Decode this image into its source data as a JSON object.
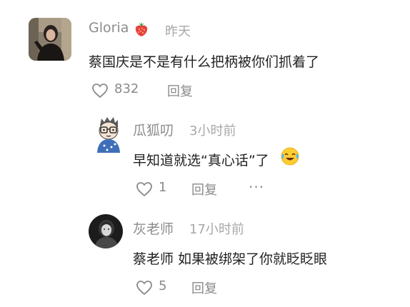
{
  "comments": [
    {
      "author": "Gloria",
      "author_emoji": "strawberry-icon",
      "time": "昨天",
      "text": "蔡国庆是不是有什么把柄被你们抓着了",
      "likes": "832",
      "reply_label": "回复",
      "replies": [
        {
          "author": "瓜狐叨",
          "time": "3小时前",
          "text": "早知道就选“真心话”了",
          "text_emoji": "laugh-cry-emoji",
          "likes": "1",
          "reply_label": "回复",
          "more_label": "···"
        },
        {
          "author": "灰老师",
          "time": "17小时前",
          "text": "蔡老师 如果被绑架了你就眨眨眼",
          "likes": "5",
          "reply_label": "回复"
        }
      ]
    }
  ],
  "colors": {
    "name": "#8c8c8c",
    "time": "#a8a8a8",
    "content": "#222222",
    "meta": "#8a8a8a",
    "background": "#ffffff"
  }
}
